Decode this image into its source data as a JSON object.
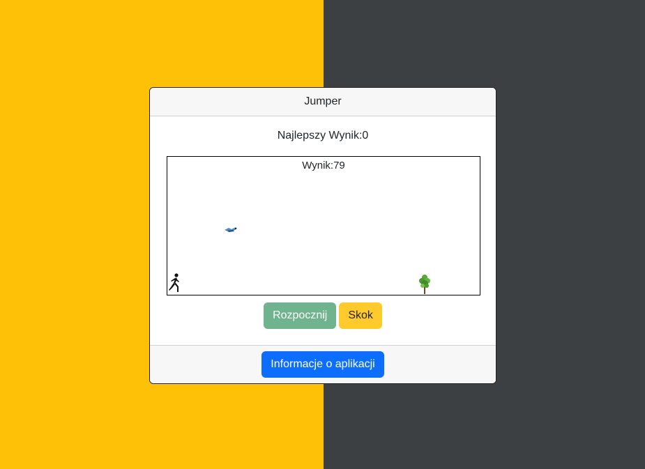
{
  "colors": {
    "left_background": "#ffc107",
    "right_background": "#3d4043",
    "start_button": "#6fb38f",
    "jump_button": "#ffca2c",
    "info_button": "#0d6efd"
  },
  "card": {
    "title": "Jumper",
    "best_score_text": "Najlepszy Wynik:0"
  },
  "game": {
    "score_text": "Wynik:79",
    "sprites": [
      "runner-icon",
      "bird-icon",
      "tree-icon"
    ]
  },
  "controls": {
    "start_label": "Rozpocznij",
    "jump_label": "Skok"
  },
  "footer": {
    "info_label": "Informacje o aplikacji"
  }
}
